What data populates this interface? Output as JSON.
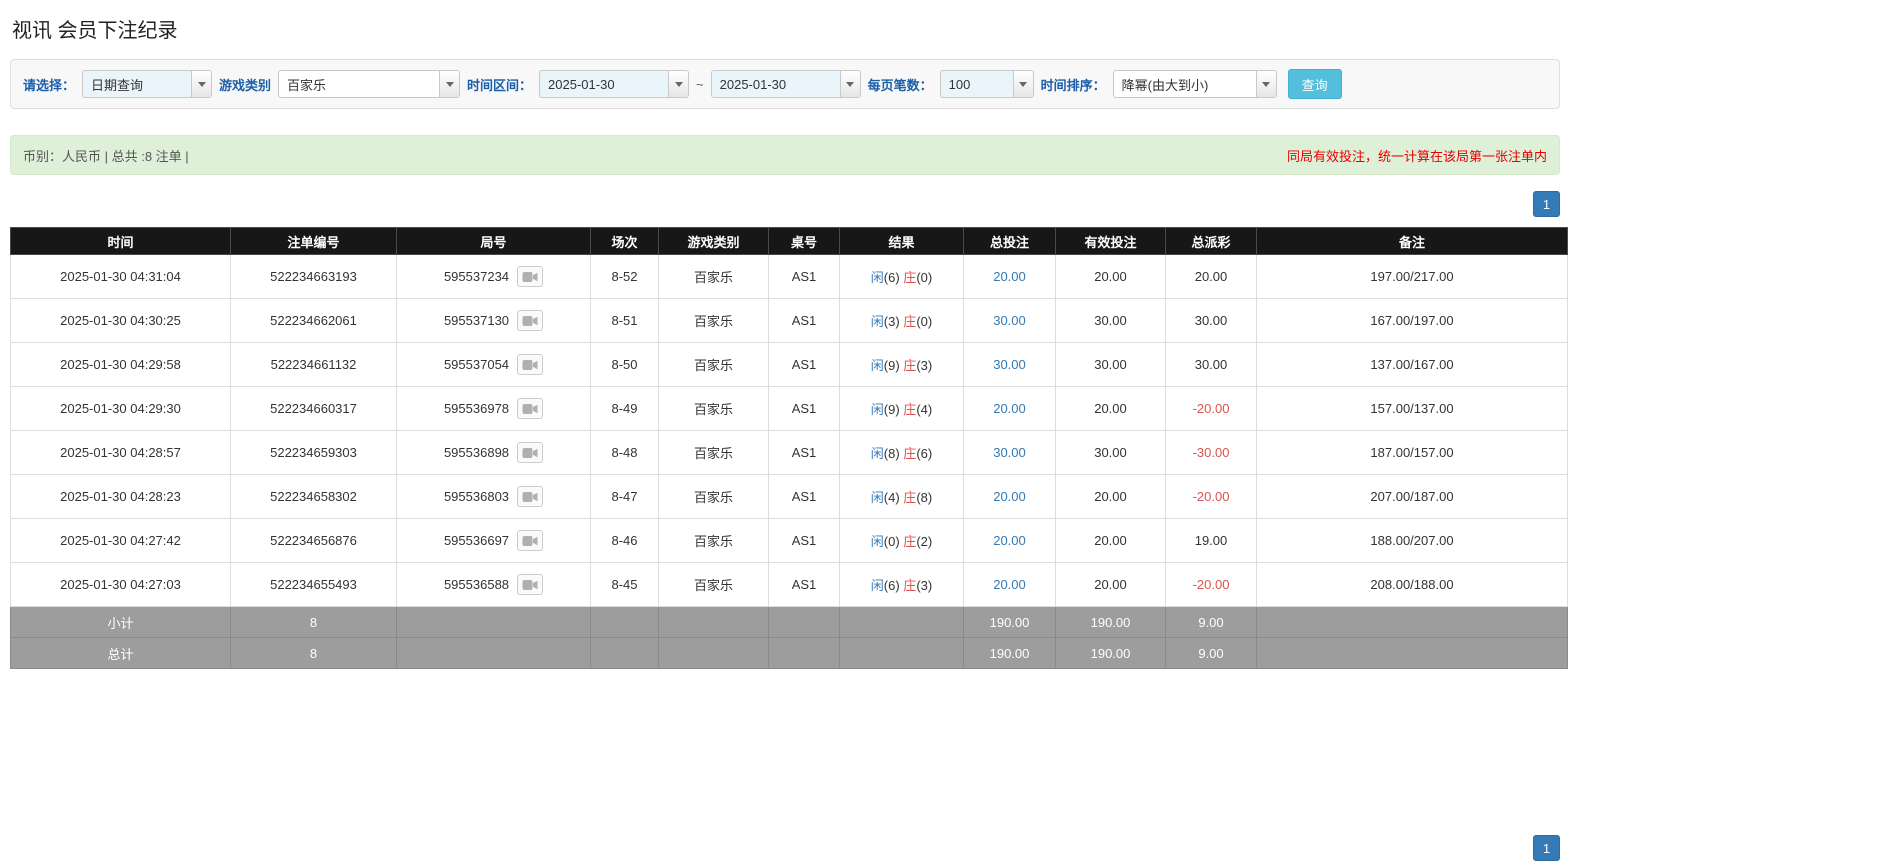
{
  "page": {
    "title": "视讯 会员下注纪录"
  },
  "filters": {
    "select_label": "请选择：",
    "select_value": "日期查询",
    "game_type_label": "游戏类别",
    "game_type_value": "百家乐",
    "time_range_label": "时间区间：",
    "date_from": "2025-01-30",
    "date_separator": "~",
    "date_to": "2025-01-30",
    "page_size_label": "每页笔数：",
    "page_size_value": "100",
    "sort_label": "时间排序：",
    "sort_value": "降幂(由大到小)",
    "search_button": "查询"
  },
  "summary": {
    "left": "币别：人民币 | 总共 :8 注单 |",
    "right": "同局有效投注，统一计算在该局第一张注单内"
  },
  "pagination": {
    "page": "1"
  },
  "table": {
    "headers": [
      "时间",
      "注单编号",
      "局号",
      "场次",
      "游戏类别",
      "桌号",
      "结果",
      "总投注",
      "有效投注",
      "总派彩",
      "备注"
    ],
    "result_labels": {
      "player": "闲",
      "banker": "庄"
    },
    "rows": [
      {
        "time": "2025-01-30 04:31:04",
        "order_id": "522234663193",
        "round_id": "595537234",
        "session": "8-52",
        "game": "百家乐",
        "table": "AS1",
        "player": "6",
        "banker": "0",
        "total_bet": "20.00",
        "valid_bet": "20.00",
        "payout": "20.00",
        "note": "197.00/217.00"
      },
      {
        "time": "2025-01-30 04:30:25",
        "order_id": "522234662061",
        "round_id": "595537130",
        "session": "8-51",
        "game": "百家乐",
        "table": "AS1",
        "player": "3",
        "banker": "0",
        "total_bet": "30.00",
        "valid_bet": "30.00",
        "payout": "30.00",
        "note": "167.00/197.00"
      },
      {
        "time": "2025-01-30 04:29:58",
        "order_id": "522234661132",
        "round_id": "595537054",
        "session": "8-50",
        "game": "百家乐",
        "table": "AS1",
        "player": "9",
        "banker": "3",
        "total_bet": "30.00",
        "valid_bet": "30.00",
        "payout": "30.00",
        "note": "137.00/167.00"
      },
      {
        "time": "2025-01-30 04:29:30",
        "order_id": "522234660317",
        "round_id": "595536978",
        "session": "8-49",
        "game": "百家乐",
        "table": "AS1",
        "player": "9",
        "banker": "4",
        "total_bet": "20.00",
        "valid_bet": "20.00",
        "payout": "-20.00",
        "note": "157.00/137.00"
      },
      {
        "time": "2025-01-30 04:28:57",
        "order_id": "522234659303",
        "round_id": "595536898",
        "session": "8-48",
        "game": "百家乐",
        "table": "AS1",
        "player": "8",
        "banker": "6",
        "total_bet": "30.00",
        "valid_bet": "30.00",
        "payout": "-30.00",
        "note": "187.00/157.00"
      },
      {
        "time": "2025-01-30 04:28:23",
        "order_id": "522234658302",
        "round_id": "595536803",
        "session": "8-47",
        "game": "百家乐",
        "table": "AS1",
        "player": "4",
        "banker": "8",
        "total_bet": "20.00",
        "valid_bet": "20.00",
        "payout": "-20.00",
        "note": "207.00/187.00"
      },
      {
        "time": "2025-01-30 04:27:42",
        "order_id": "522234656876",
        "round_id": "595536697",
        "session": "8-46",
        "game": "百家乐",
        "table": "AS1",
        "player": "0",
        "banker": "2",
        "total_bet": "20.00",
        "valid_bet": "20.00",
        "payout": "19.00",
        "note": "188.00/207.00"
      },
      {
        "time": "2025-01-30 04:27:03",
        "order_id": "522234655493",
        "round_id": "595536588",
        "session": "8-45",
        "game": "百家乐",
        "table": "AS1",
        "player": "6",
        "banker": "3",
        "total_bet": "20.00",
        "valid_bet": "20.00",
        "payout": "-20.00",
        "note": "208.00/188.00"
      }
    ],
    "subtotal": {
      "label": "小计",
      "count": "8",
      "total_bet": "190.00",
      "valid_bet": "190.00",
      "payout": "9.00"
    },
    "total": {
      "label": "总计",
      "count": "8",
      "total_bet": "190.00",
      "valid_bet": "190.00",
      "payout": "9.00"
    }
  }
}
